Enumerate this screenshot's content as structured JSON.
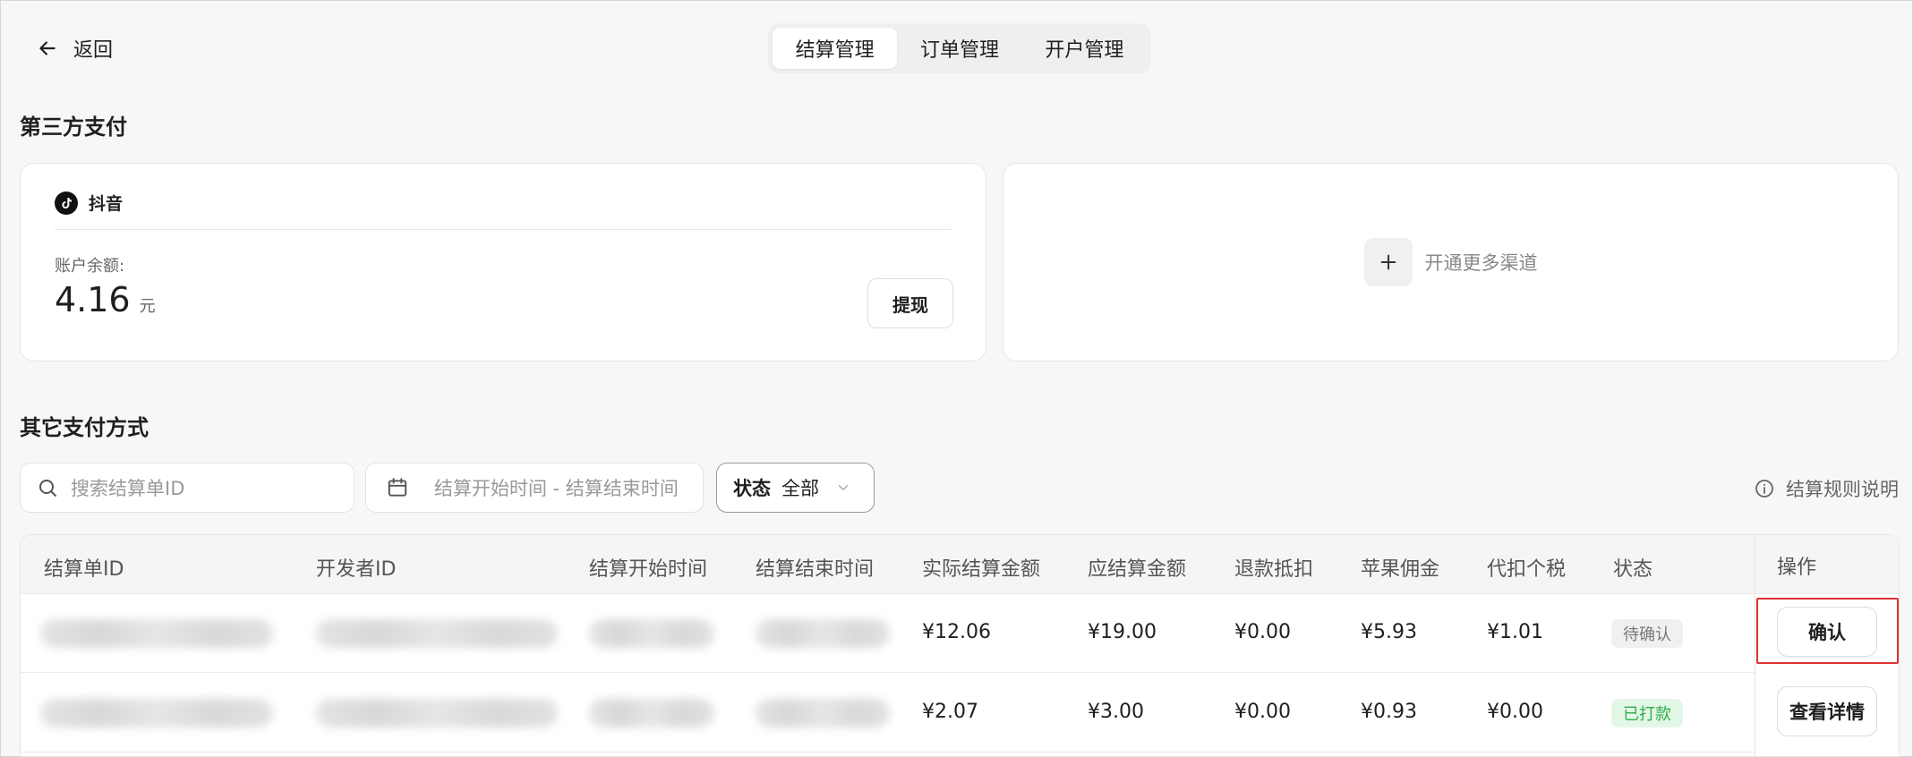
{
  "header": {
    "back_label": "返回",
    "tabs": [
      {
        "label": "结算管理",
        "active": true
      },
      {
        "label": "订单管理",
        "active": false
      },
      {
        "label": "开户管理",
        "active": false
      }
    ]
  },
  "third_party": {
    "title": "第三方支付",
    "platform_name": "抖音",
    "balance_label": "账户余额:",
    "balance_value": "4.16",
    "balance_unit": "元",
    "withdraw_label": "提现",
    "more_channels_label": "开通更多渠道"
  },
  "other_payments": {
    "title": "其它支付方式",
    "search_placeholder": "搜索结算单ID",
    "date_range_placeholder": "结算开始时间 - 结算结束时间",
    "status_filter_key": "状态",
    "status_filter_value": "全部",
    "rules_label": "结算规则说明"
  },
  "table": {
    "columns": [
      "结算单ID",
      "开发者ID",
      "结算开始时间",
      "结算结束时间",
      "实际结算金额",
      "应结算金额",
      "退款抵扣",
      "苹果佣金",
      "代扣个税",
      "状态",
      "操作"
    ],
    "rows": [
      {
        "actual": "¥12.06",
        "due": "¥19.00",
        "refund": "¥0.00",
        "apple": "¥5.93",
        "tax": "¥1.01",
        "status": "待确认",
        "action": "确认"
      },
      {
        "actual": "¥2.07",
        "due": "¥3.00",
        "refund": "¥0.00",
        "apple": "¥0.93",
        "tax": "¥0.00",
        "status": "已打款",
        "action": "查看详情"
      }
    ]
  },
  "colors": {
    "highlight_border": "#e03131",
    "paid_text": "#2fae4a",
    "paid_bg": "#e3f7e6"
  }
}
